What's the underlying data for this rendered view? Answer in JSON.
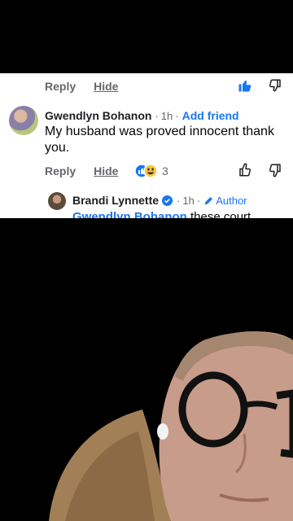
{
  "comment1": {
    "reply_label": "Reply",
    "hide_label": "Hide"
  },
  "comment2": {
    "author": "Gwendlyn Bohanon",
    "separator1": "·",
    "time": "1h",
    "separator2": "·",
    "add_friend_label": "Add friend",
    "text": "My husband was proved innocent thank you.",
    "reply_label": "Reply",
    "hide_label": "Hide",
    "reaction_count": "3"
  },
  "reply": {
    "author": "Brandi Lynnette",
    "separator1": "·",
    "time": "1h",
    "separator2": "·",
    "author_badge": "Author",
    "text_mention": "Gwendlyn Bohanon",
    "text_rest": " these court"
  },
  "colors": {
    "accent": "#1877f2",
    "muted": "#65676b",
    "text": "#050505"
  }
}
